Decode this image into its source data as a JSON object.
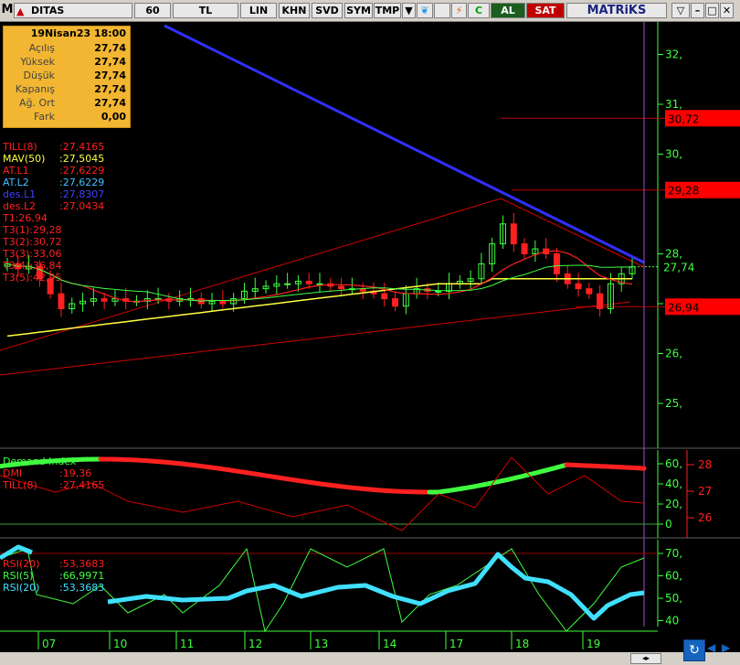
{
  "toolbar": {
    "symbol": "DITAS",
    "period": "60",
    "currency": "TL",
    "scale": "LIN",
    "btn_khn": "KHN",
    "btn_svd": "SVD",
    "btn_sym": "SYM",
    "btn_tmp": "TMP",
    "btn_c": "C",
    "buy_label": "AL",
    "sell_label": "SAT",
    "brand": "MATRiKS",
    "logo_letter": "M"
  },
  "info_box": {
    "header": "19Nisan23 18:00",
    "rows": [
      {
        "label": "Açılış",
        "value": "27,74"
      },
      {
        "label": "Yüksek",
        "value": "27,74"
      },
      {
        "label": "Düşük",
        "value": "27,74"
      },
      {
        "label": "Kapanış",
        "value": "27,74"
      },
      {
        "label": "Ağ. Ort",
        "value": "27,74"
      },
      {
        "label": "Fark",
        "value": "0,00"
      }
    ]
  },
  "main_legend": [
    {
      "label": "TILL(8)",
      "value": ":27,4165",
      "color": "#ff2020"
    },
    {
      "label": "MAV(50)",
      "value": ":27,5045",
      "color": "#ffff40"
    },
    {
      "label": "AT.L1",
      "value": ":27,6229",
      "color": "#ff2020"
    },
    {
      "label": "AT.L2",
      "value": ":27,6229",
      "color": "#40c0ff"
    },
    {
      "label": "des.L1",
      "value": ":27,8307",
      "color": "#4040ff"
    },
    {
      "label": "des.L2",
      "value": ":27,0434",
      "color": "#ff2020"
    },
    {
      "label": "T1:26,94",
      "value": "",
      "color": "#ff2020"
    },
    {
      "label": "T3(1):29,28",
      "value": "",
      "color": "#ff2020"
    },
    {
      "label": "T3(2):30,72",
      "value": "",
      "color": "#ff2020"
    },
    {
      "label": "T3(3):33,06",
      "value": "",
      "color": "#ff2020"
    },
    {
      "label": "T3(4):36,84",
      "value": "",
      "color": "#ff2020"
    },
    {
      "label": "T3(5):42,95",
      "value": "",
      "color": "#ff2020"
    }
  ],
  "dmi_legend": [
    {
      "label": "Demand Index",
      "value": "",
      "color": "#40ff40"
    },
    {
      "label": "DMI",
      "value": ":19,36",
      "color": "#ff2020"
    },
    {
      "label": "TILL(8)",
      "value": ":27,4165",
      "color": "#ff2020"
    }
  ],
  "rsi_legend": [
    {
      "label": "RSI(20)",
      "value": ":53,3683",
      "color": "#ff2020"
    },
    {
      "label": "RSI(5)",
      "value": ":66,9971",
      "color": "#40ff40"
    },
    {
      "label": "RSI(20)",
      "value": ":53,3683",
      "color": "#40e0ff"
    }
  ],
  "price_axis": {
    "ticks": [
      "32,",
      "31,",
      "30,",
      "28,",
      "27,",
      "26,",
      "25,"
    ],
    "tick_values": [
      32,
      31,
      30,
      28,
      27,
      26,
      25
    ],
    "current_label": "27,74",
    "level_labels": [
      "30,72",
      "29,28",
      "26,94"
    ],
    "level_values": [
      30.72,
      29.28,
      26.94
    ]
  },
  "dmi_axis": {
    "ticks": [
      "60,",
      "40,",
      "20,",
      "0"
    ],
    "tick_values": [
      60,
      40,
      20,
      0
    ],
    "right_ticks": [
      "28",
      "27",
      "26"
    ]
  },
  "rsi_axis": {
    "ticks": [
      "70,",
      "60,",
      "50,",
      "40"
    ],
    "tick_values": [
      70,
      60,
      50,
      40
    ]
  },
  "time_axis": {
    "labels": [
      "07",
      "10",
      "11",
      "12",
      "13",
      "14",
      "17",
      "18",
      "19"
    ]
  },
  "colors": {
    "background": "#000000",
    "up": "#40ff40",
    "down": "#ff2020",
    "trend": "#3030ff",
    "mav": "#ffff40",
    "rsi20": "#40e0ff",
    "cursor": "#a050d0"
  },
  "chart_data": {
    "type": "candlestick",
    "timeframe": "60",
    "symbol": "DITAS",
    "x_labels": [
      "07",
      "10",
      "11",
      "12",
      "13",
      "14",
      "17",
      "18",
      "19"
    ],
    "ylim": [
      24.6,
      32.6
    ],
    "closes": [
      27.8,
      27.7,
      27.75,
      27.5,
      27.2,
      26.9,
      27.0,
      27.05,
      27.1,
      27.05,
      27.1,
      27.05,
      27.05,
      27.1,
      27.1,
      27.05,
      27.1,
      27.1,
      27.0,
      27.05,
      27.0,
      27.1,
      27.25,
      27.3,
      27.35,
      27.4,
      27.4,
      27.45,
      27.4,
      27.4,
      27.35,
      27.3,
      27.3,
      27.25,
      27.2,
      27.1,
      26.95,
      27.2,
      27.3,
      27.25,
      27.25,
      27.4,
      27.45,
      27.5,
      27.8,
      28.2,
      28.6,
      28.2,
      28.0,
      28.1,
      28.0,
      27.6,
      27.4,
      27.3,
      27.2,
      26.9,
      27.4,
      27.6,
      27.74
    ],
    "series": [
      {
        "name": "MAV(50)",
        "last": 27.5045
      },
      {
        "name": "TILL(8)",
        "last": 27.4165
      },
      {
        "name": "des.L1",
        "last": 27.8307
      },
      {
        "name": "des.L2",
        "last": 27.0434
      }
    ],
    "levels": [
      30.72,
      29.28,
      26.94
    ],
    "dmi": {
      "value": 19.36,
      "range": [
        0,
        70
      ]
    },
    "rsi": {
      "rsi20": 53.3683,
      "rsi5": 66.9971,
      "range": [
        38,
        72
      ]
    }
  }
}
